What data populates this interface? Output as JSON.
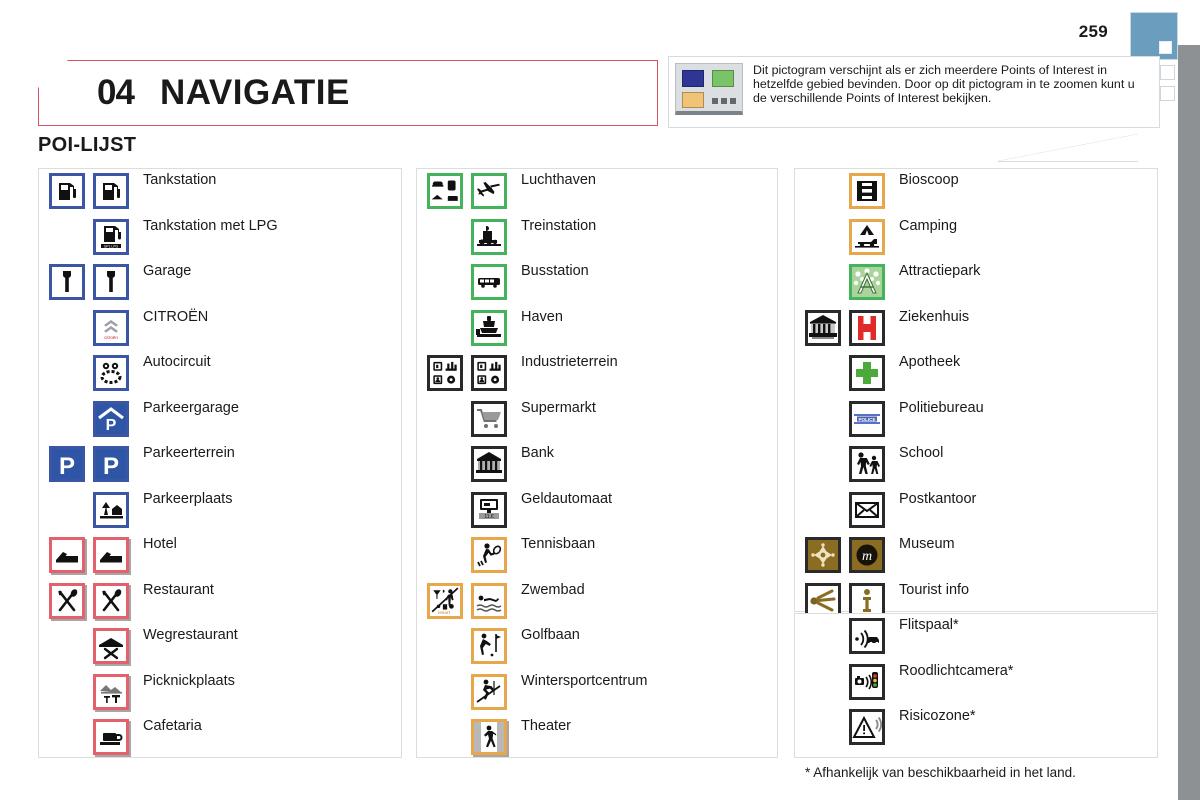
{
  "page": {
    "number": "259"
  },
  "chapter": {
    "number": "04",
    "title": "NAVIGATIE"
  },
  "note": {
    "icon": "multi-poi-pictogram",
    "text": "Dit pictogram verschijnt als er zich meerdere Points of Interest in hetzelfde gebied bevinden. Door op dit pictogram in te zoomen kunt u de verschillende Points of Interest bekijken."
  },
  "section": {
    "title": "POI-LIJST"
  },
  "footnote": "* Afhankelijk van beschikbaarheid in het land.",
  "columns": [
    {
      "id": "column-1",
      "rows": [
        {
          "label": "Tankstation",
          "left": "fuel-pump-icon",
          "right": "fuel-pump-icon",
          "style": "blue"
        },
        {
          "label": "Tankstation met LPG",
          "left": null,
          "right": "fuel-pump-lpg-icon",
          "style": "blue"
        },
        {
          "label": "Garage",
          "left": "wrench-icon",
          "right": "wrench-icon",
          "style": "blue"
        },
        {
          "label": "CITROËN",
          "left": null,
          "right": "citroen-logo-icon",
          "style": "blue"
        },
        {
          "label": "Autocircuit",
          "left": null,
          "right": "race-circuit-icon",
          "style": "blue"
        },
        {
          "label": "Parkeergarage",
          "left": null,
          "right": "parking-garage-icon",
          "style": "blue-filled"
        },
        {
          "label": "Parkeerterrein",
          "left": "parking-p-icon",
          "right": "parking-p-icon",
          "style": "blue-filled"
        },
        {
          "label": "Parkeerplaats",
          "left": null,
          "right": "rest-area-icon",
          "style": "blue"
        },
        {
          "label": "Hotel",
          "left": "bed-icon",
          "right": "bed-icon",
          "style": "red"
        },
        {
          "label": "Restaurant",
          "left": "cutlery-icon",
          "right": "cutlery-icon",
          "style": "red"
        },
        {
          "label": "Wegrestaurant",
          "left": null,
          "right": "roadside-diner-icon",
          "style": "red"
        },
        {
          "label": "Picknickplaats",
          "left": null,
          "right": "picnic-table-icon",
          "style": "red"
        },
        {
          "label": "Cafetaria",
          "left": null,
          "right": "coffee-cup-icon",
          "style": "red"
        }
      ]
    },
    {
      "id": "column-2",
      "rows": [
        {
          "label": "Luchthaven",
          "left": "transport-hub-icon",
          "right": "airplane-icon",
          "style": "green"
        },
        {
          "label": "Treinstation",
          "left": null,
          "right": "train-icon",
          "style": "green"
        },
        {
          "label": "Busstation",
          "left": null,
          "right": "bus-icon",
          "style": "green"
        },
        {
          "label": "Haven",
          "left": null,
          "right": "ferry-icon",
          "style": "green"
        },
        {
          "label": "Industrieterrein",
          "left": "industrial-area-icon",
          "right": "industrial-area-icon",
          "style": "black"
        },
        {
          "label": "Supermarkt",
          "left": null,
          "right": "shopping-cart-icon",
          "style": "black"
        },
        {
          "label": "Bank",
          "left": null,
          "right": "bank-building-icon",
          "style": "black"
        },
        {
          "label": "Geldautomaat",
          "left": null,
          "right": "atm-icon",
          "style": "black"
        },
        {
          "label": "Tennisbaan",
          "left": null,
          "right": "tennis-icon",
          "style": "orange"
        },
        {
          "label": "Zwembad",
          "left": "leisure-mix-icon",
          "right": "swimmer-icon",
          "style": "orange"
        },
        {
          "label": "Golfbaan",
          "left": null,
          "right": "golf-icon",
          "style": "orange"
        },
        {
          "label": "Wintersportcentrum",
          "left": null,
          "right": "skier-icon",
          "style": "orange"
        },
        {
          "label": "Theater",
          "left": null,
          "right": "theater-icon",
          "style": "orange-filled"
        }
      ]
    },
    {
      "id": "column-3",
      "rows": [
        {
          "label": "Bioscoop",
          "left": null,
          "right": "film-reel-icon",
          "style": "orange"
        },
        {
          "label": "Camping",
          "left": null,
          "right": "camping-icon",
          "style": "orange"
        },
        {
          "label": "Attractiepark",
          "left": null,
          "right": "amusement-park-icon",
          "style": "green-filled"
        },
        {
          "label": "Ziekenhuis",
          "left": "monument-icon",
          "right": "hospital-h-icon",
          "style": "black"
        },
        {
          "label": "Apotheek",
          "left": null,
          "right": "pharmacy-cross-icon",
          "style": "black"
        },
        {
          "label": "Politiebureau",
          "left": null,
          "right": "police-icon",
          "style": "black"
        },
        {
          "label": "School",
          "left": null,
          "right": "school-children-icon",
          "style": "black"
        },
        {
          "label": "Postkantoor",
          "left": null,
          "right": "envelope-icon",
          "style": "black"
        },
        {
          "label": "Museum",
          "left": "ornament-icon",
          "right": "museum-m-icon",
          "style": "gold-filled"
        },
        {
          "label": "Tourist info",
          "left": "info-beacon-icon",
          "right": "info-i-icon",
          "style": "gold"
        }
      ]
    },
    {
      "id": "column-4",
      "rows": [
        {
          "label": "Flitspaal*",
          "left": null,
          "right": "speed-camera-icon",
          "style": "black"
        },
        {
          "label": "Roodlichtcamera*",
          "left": null,
          "right": "red-light-camera-icon",
          "style": "black"
        },
        {
          "label": "Risicozone*",
          "left": null,
          "right": "risk-zone-icon",
          "style": "black"
        }
      ]
    }
  ],
  "colors": {
    "accent_red": "#d9535f",
    "blue_border": "#3a56a5",
    "green_border": "#45b35c",
    "orange_border": "#e6a84b",
    "gold": "#6b5318",
    "rail_gray": "#8e9194",
    "tab_blue": "#6b9dbf"
  }
}
